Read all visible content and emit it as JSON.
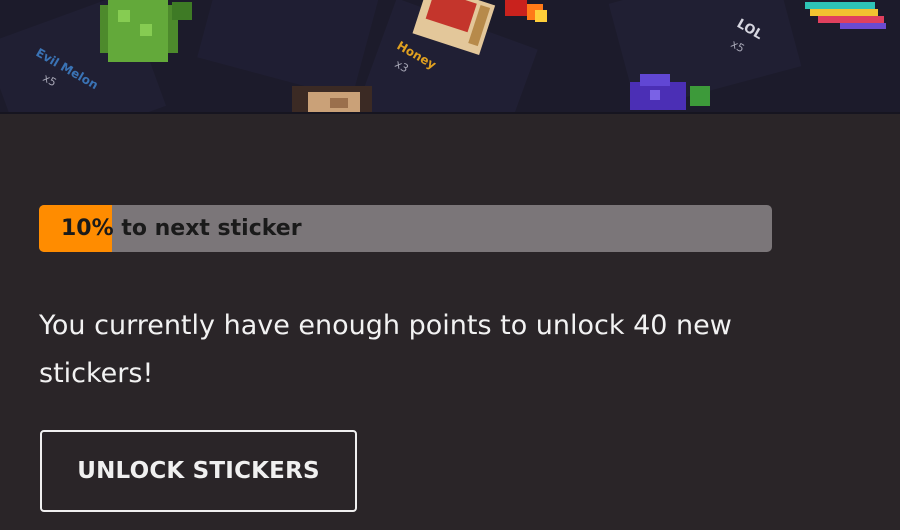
{
  "banner": {
    "stickers": [
      {
        "label": "Evil Melon",
        "count": "x5",
        "icon": "pixel-melon-icon"
      },
      {
        "label": "Honey",
        "count": "x3",
        "icon": "pixel-honey-jar-icon"
      },
      {
        "label": "LOL",
        "count": "x5",
        "icon": "pixel-lol-icon"
      },
      {
        "label": "",
        "count": "",
        "icon": "pixel-flame-icon"
      },
      {
        "label": "",
        "count": "",
        "icon": "pixel-rainbow-icon"
      },
      {
        "label": "",
        "count": "",
        "icon": "pixel-grapes-icon"
      },
      {
        "label": "",
        "count": "",
        "icon": "pixel-face-icon"
      }
    ]
  },
  "progress": {
    "percent": 10,
    "label": "10% to next sticker",
    "fill_color": "#ff8c00",
    "track_color": "#7b7679"
  },
  "message": "You currently have enough points to unlock 40 new stickers!",
  "unlock_button": {
    "label": "UNLOCK STICKERS"
  },
  "colors": {
    "background": "#2a2528",
    "text": "#f2f2f2"
  }
}
